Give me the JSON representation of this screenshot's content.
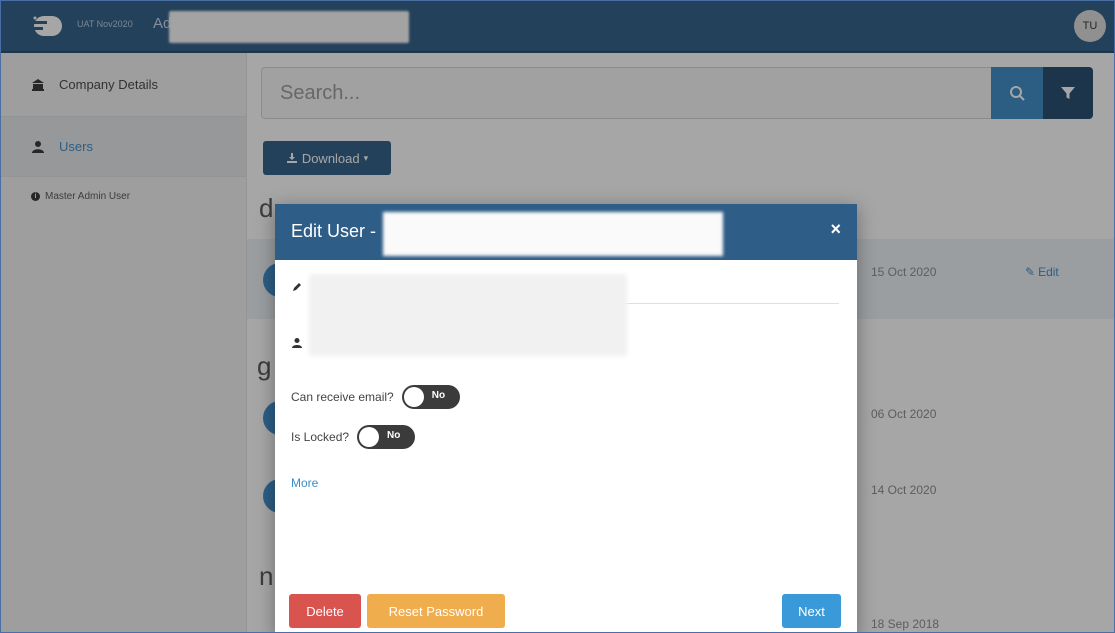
{
  "header": {
    "env_label": "UAT Nov2020",
    "app_title": "Ad",
    "avatar_initials": "TU"
  },
  "sidebar": {
    "items": [
      {
        "label": "Company Details",
        "icon": "bank-icon",
        "active": false
      },
      {
        "label": "Users",
        "icon": "user-icon",
        "active": true
      }
    ],
    "sub_label": "Master Admin User"
  },
  "main": {
    "search_placeholder": "Search...",
    "download_label": "Download",
    "groups": [
      "d",
      "g",
      "n"
    ],
    "rows": [
      {
        "date": "15 Oct 2020",
        "edit_label": "Edit"
      },
      {
        "date": "06 Oct 2020"
      },
      {
        "date": "14 Oct 2020"
      },
      {
        "date": "18 Sep 2018"
      }
    ]
  },
  "modal": {
    "title": "Edit User -",
    "close_symbol": "×",
    "can_receive_email_label": "Can receive email?",
    "can_receive_email_value": "No",
    "is_locked_label": "Is Locked?",
    "is_locked_value": "No",
    "more_label": "More",
    "delete_label": "Delete",
    "reset_password_label": "Reset Password",
    "next_label": "Next"
  },
  "colors": {
    "primary": "#2e5d87",
    "accent": "#3a8cc9",
    "danger": "#d9534f",
    "warning": "#f0ad4e"
  }
}
